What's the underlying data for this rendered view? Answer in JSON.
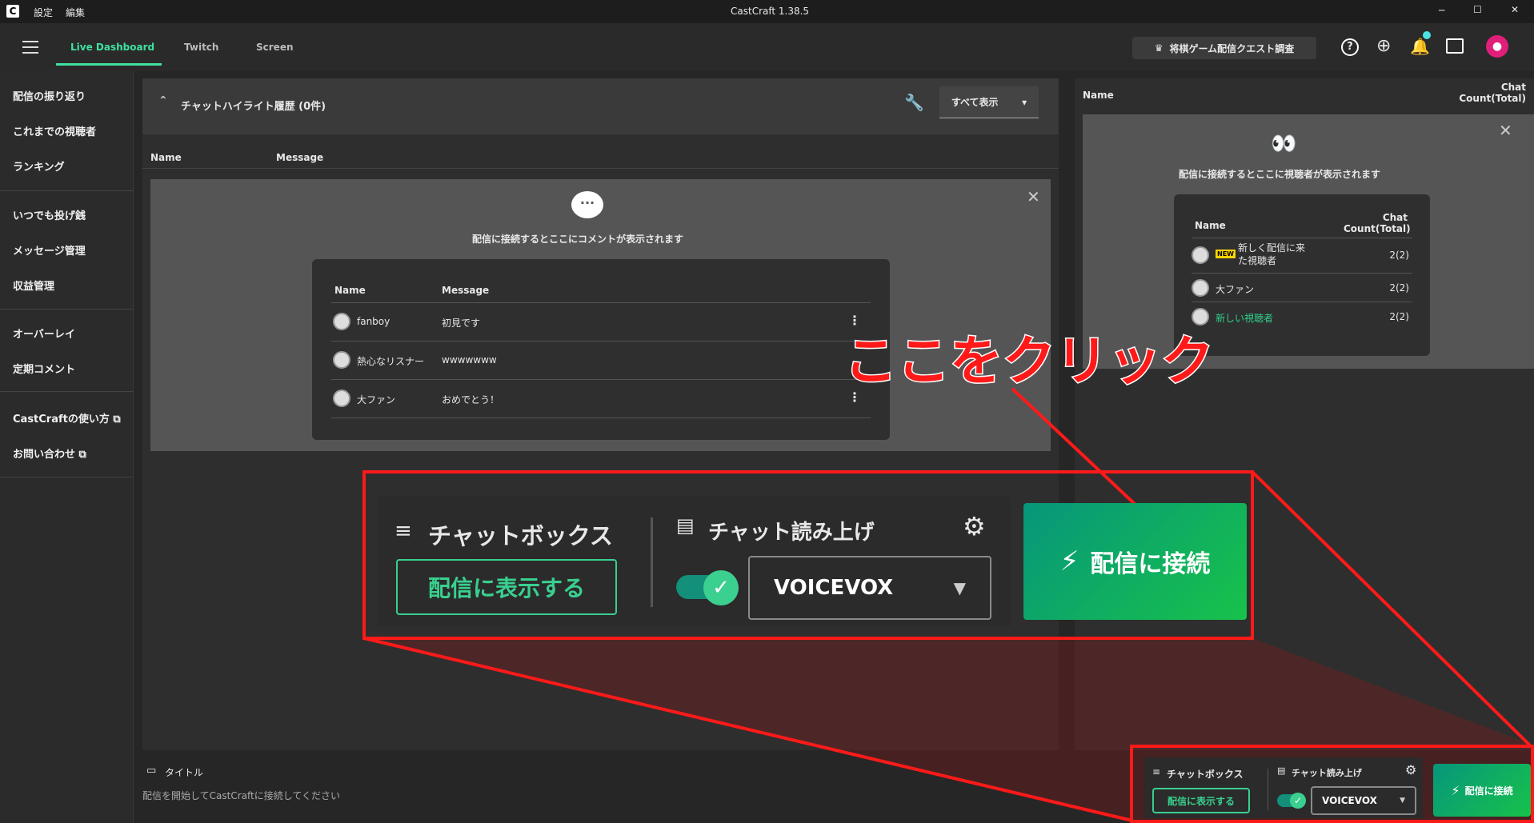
{
  "window": {
    "title": "CastCraft 1.38.5",
    "menu": [
      "設定",
      "編集"
    ],
    "controls": [
      "─",
      "☐",
      "✕"
    ]
  },
  "appbar": {
    "tabs": [
      "Live Dashboard",
      "Twitch",
      "Screen"
    ],
    "survey": "将棋ゲーム配信クエスト調査"
  },
  "sidebar": {
    "groups": [
      [
        "配信の振り返り",
        "これまでの視聴者",
        "ランキング"
      ],
      [
        "いつでも投げ銭",
        "メッセージ管理",
        "収益管理"
      ],
      [
        "オーバーレイ",
        "定期コメント"
      ],
      [
        "CastCraftの使い方",
        "お問い合わせ"
      ]
    ]
  },
  "highlight": {
    "title": "チャットハイライト履歴 (0件)",
    "filter": "すべて表示"
  },
  "chat": {
    "col_name": "Name",
    "col_message": "Message",
    "empty_message": "配信に接続するとここにコメントが表示されます",
    "rows": [
      {
        "name": "fanboy",
        "message": "初見です"
      },
      {
        "name": "熱心なリスナー",
        "message": "wwwwwww"
      },
      {
        "name": "大ファン",
        "message": "おめでとう！"
      }
    ]
  },
  "viewers": {
    "col_name": "Name",
    "col_count": "Chat Count(Total)",
    "empty_message": "配信に接続するとここに視聴者が表示されます",
    "rows": [
      {
        "name": "新しく配信に来た視聴者",
        "badge": "NEW",
        "count": "2(2)"
      },
      {
        "name": "大ファン",
        "count": "2(2)"
      },
      {
        "name": "新しい視聴者",
        "count": "2(2)",
        "accent": "#2fd08a"
      }
    ]
  },
  "footer": {
    "title_label": "タイトル",
    "title_hint": "配信を開始してCastCraftに接続してください"
  },
  "controls": {
    "chatbox": "チャットボックス",
    "show_button": "配信に表示する",
    "tts": "チャット読み上げ",
    "tts_engine": "VOICEVOX",
    "connect": "配信に接続"
  },
  "annotation": {
    "text": "ここをクリック",
    "color": "#ff1a1a"
  }
}
